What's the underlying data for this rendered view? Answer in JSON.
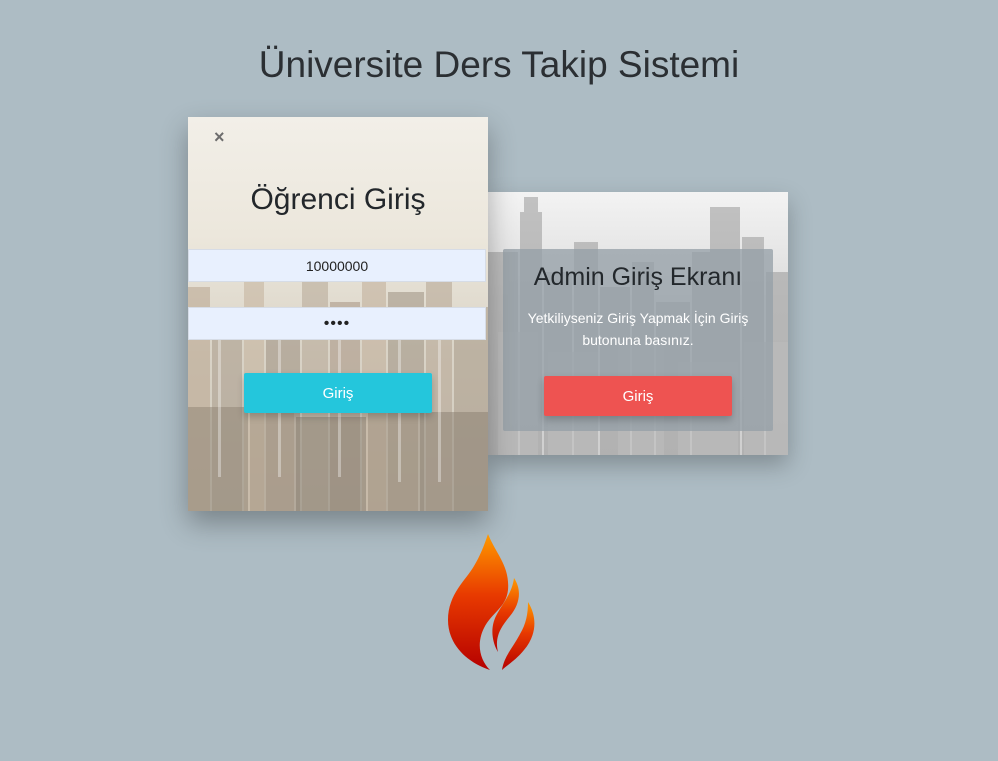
{
  "page": {
    "title": "Üniversite Ders Takip Sistemi"
  },
  "student_login": {
    "title": "Öğrenci Giriş",
    "close_symbol": "×",
    "number_value": "10000000",
    "password_value": "••••",
    "button_label": "Giriş",
    "button_color": "#24c6dc"
  },
  "admin_login": {
    "title": "Admin Giriş Ekranı",
    "description": "Yetkiliyseniz Giriş Yapmak İçin Giriş butonuna basınız.",
    "button_label": "Giriş",
    "button_color": "#ee5351"
  },
  "logo": {
    "icon": "flame-icon"
  },
  "colors": {
    "background": "#adbcc4",
    "input_background": "#e8f0fe"
  }
}
